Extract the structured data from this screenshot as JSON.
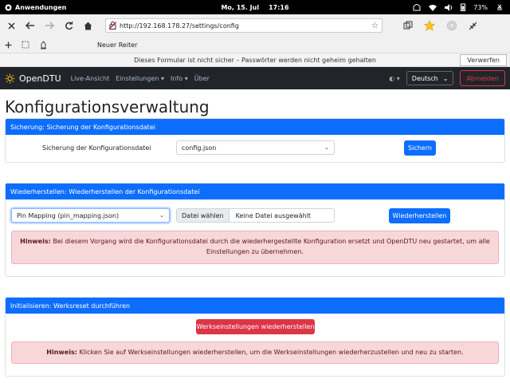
{
  "system_bar": {
    "apps_label": "Anwendungen",
    "date": "Mo, 15. Jul",
    "time": "17:16",
    "battery": "73%"
  },
  "browser": {
    "url": "http://192.168.178.27/settings/config",
    "new_tab_label": "Neuer Reiter",
    "security_warning": "Dieses Formular ist nicht sicher – Passwörter werden nicht geheim gehalten",
    "dismiss_label": "Verwerfen"
  },
  "navbar": {
    "brand": "OpenDTU",
    "links": {
      "live": "Live-Ansicht",
      "settings": "Einstellungen",
      "info": "Info",
      "about": "Über"
    },
    "language": "Deutsch",
    "logout": "Abmelden"
  },
  "page": {
    "title": "Konfigurationsverwaltung",
    "backup": {
      "header": "Sicherung: Sicherung der Konfigurationsdatei",
      "label": "Sicherung der Konfigurationsdatei",
      "selected_file": "config.json",
      "button": "Sichern"
    },
    "restore": {
      "header": "Wiederherstellen: Wiederherstellen der Konfigurationsdatei",
      "selected_file": "Pin Mapping (pin_mapping.json)",
      "choose_file": "Datei wählen",
      "no_file": "Keine Datei ausgewählt",
      "button": "Wiederherstellen",
      "hint_label": "Hinweis:",
      "hint_text": "Bei diesem Vorgang wird die Konfigurationsdatei durch die wiederhergestellte Konfiguration ersetzt und OpenDTU neu gestartet, um alle Einstellungen zu übernehmen."
    },
    "reset": {
      "header": "Initialisieren: Werksreset durchführen",
      "button": "Werkseinstellungen wiederherstellen",
      "hint_label": "Hinweis:",
      "hint_text": "Klicken Sie auf Werkseinstellungen wiederherstellen, um die Werkseinstellungen wiederherzustellen und neu zu starten."
    }
  },
  "colors": {
    "primary": "#0d6efd",
    "danger": "#dc3545",
    "navbar": "#212529",
    "alert_bg": "#f8d7da"
  }
}
